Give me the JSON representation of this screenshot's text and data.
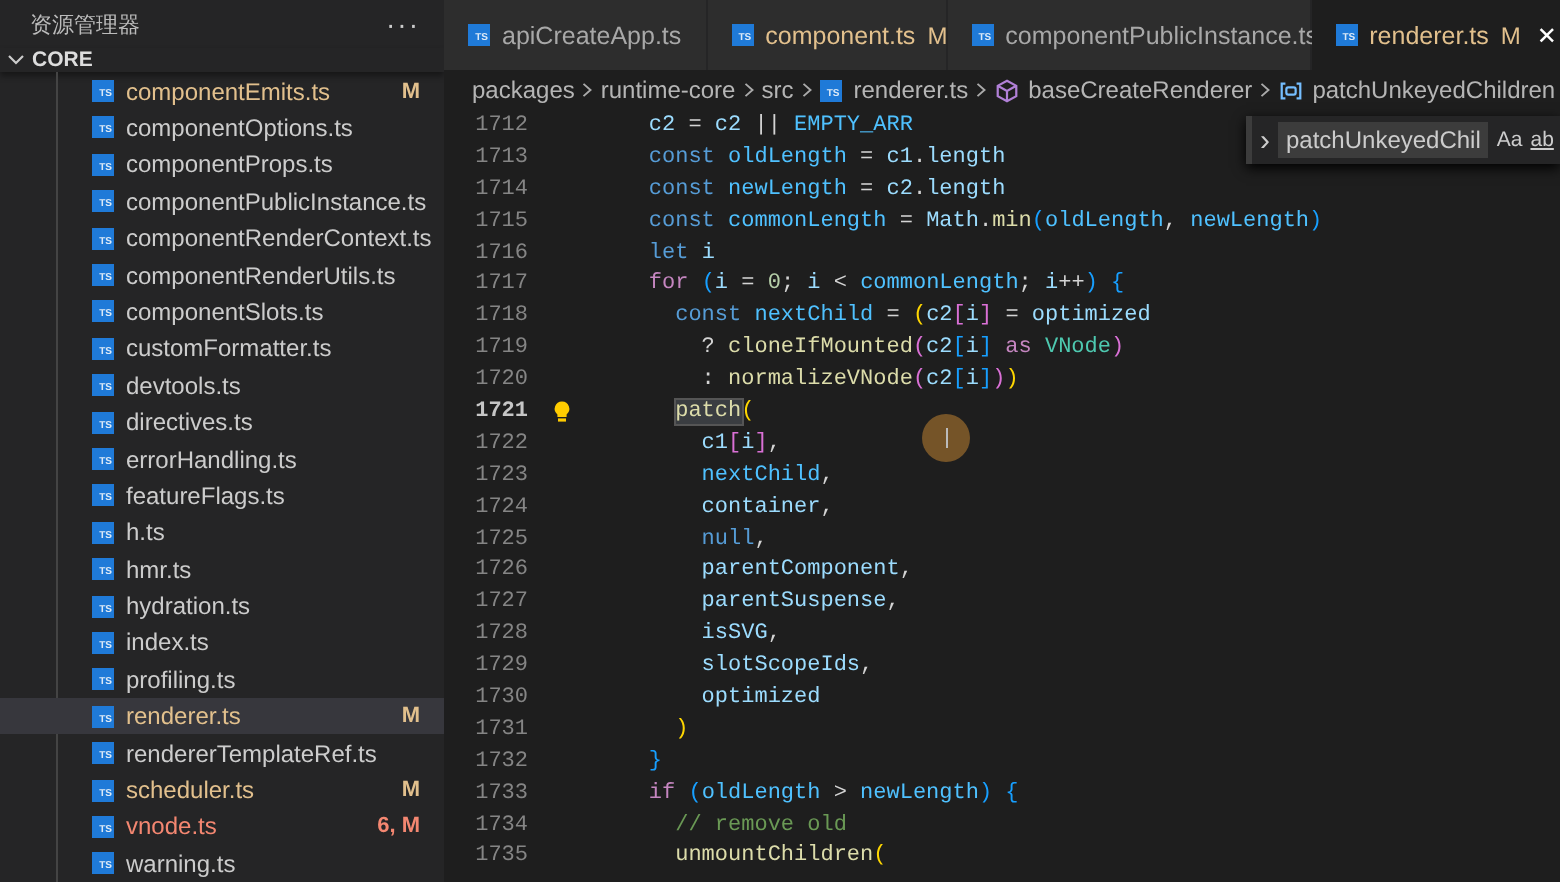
{
  "sidebar": {
    "title": "资源管理器",
    "more": "···",
    "section": {
      "label": "CORE",
      "expanded": true
    },
    "files": [
      {
        "badge": "TS",
        "name": "componentEmits.ts",
        "status": "M",
        "kind": "modified",
        "selected": false
      },
      {
        "badge": "TS",
        "name": "componentOptions.ts",
        "kind": "clean",
        "selected": false
      },
      {
        "badge": "TS",
        "name": "componentProps.ts",
        "kind": "clean",
        "selected": false
      },
      {
        "badge": "TS",
        "name": "componentPublicInstance.ts",
        "kind": "clean",
        "selected": false
      },
      {
        "badge": "TS",
        "name": "componentRenderContext.ts",
        "kind": "clean",
        "selected": false
      },
      {
        "badge": "TS",
        "name": "componentRenderUtils.ts",
        "kind": "clean",
        "selected": false
      },
      {
        "badge": "TS",
        "name": "componentSlots.ts",
        "kind": "clean",
        "selected": false
      },
      {
        "badge": "TS",
        "name": "customFormatter.ts",
        "kind": "clean",
        "selected": false
      },
      {
        "badge": "TS",
        "name": "devtools.ts",
        "kind": "clean",
        "selected": false
      },
      {
        "badge": "TS",
        "name": "directives.ts",
        "kind": "clean",
        "selected": false
      },
      {
        "badge": "TS",
        "name": "errorHandling.ts",
        "kind": "clean",
        "selected": false
      },
      {
        "badge": "TS",
        "name": "featureFlags.ts",
        "kind": "clean",
        "selected": false
      },
      {
        "badge": "TS",
        "name": "h.ts",
        "kind": "clean",
        "selected": false
      },
      {
        "badge": "TS",
        "name": "hmr.ts",
        "kind": "clean",
        "selected": false
      },
      {
        "badge": "TS",
        "name": "hydration.ts",
        "kind": "clean",
        "selected": false
      },
      {
        "badge": "TS",
        "name": "index.ts",
        "kind": "clean",
        "selected": false
      },
      {
        "badge": "TS",
        "name": "profiling.ts",
        "kind": "clean",
        "selected": false
      },
      {
        "badge": "TS",
        "name": "renderer.ts",
        "status": "M",
        "kind": "modified",
        "selected": true
      },
      {
        "badge": "TS",
        "name": "rendererTemplateRef.ts",
        "kind": "clean",
        "selected": false
      },
      {
        "badge": "TS",
        "name": "scheduler.ts",
        "status": "M",
        "kind": "modified",
        "selected": false
      },
      {
        "badge": "TS",
        "name": "vnode.ts",
        "status": "6, M",
        "kind": "error",
        "selected": false
      },
      {
        "badge": "TS",
        "name": "warning.ts",
        "kind": "clean",
        "selected": false
      }
    ]
  },
  "tabs": [
    {
      "badge": "TS",
      "label": "apiCreateApp.ts",
      "selected": false,
      "kind": "clean"
    },
    {
      "badge": "TS",
      "label": "component.ts",
      "status": "M",
      "selected": false,
      "kind": "modified"
    },
    {
      "badge": "TS",
      "label": "componentPublicInstance.ts",
      "selected": false,
      "kind": "clean"
    },
    {
      "badge": "TS",
      "label": "renderer.ts",
      "status": "M",
      "selected": true,
      "kind": "modified",
      "close": "✕"
    }
  ],
  "breadcrumb": [
    {
      "label": "packages",
      "kind": "folder"
    },
    {
      "label": "runtime-core",
      "kind": "folder"
    },
    {
      "label": "src",
      "kind": "folder"
    },
    {
      "label": "renderer.ts",
      "kind": "file",
      "badge": "TS"
    },
    {
      "label": "baseCreateRenderer",
      "kind": "function"
    },
    {
      "label": "patchUnkeyedChildren",
      "kind": "variable"
    }
  ],
  "find_widget": {
    "chevron": "›",
    "value": "patchUnkeyedChil",
    "match_case": "Aa",
    "whole_word": "ab"
  },
  "code": [
    {
      "number": "1712",
      "current": false,
      "tokens": [
        {
          "t": "    c2",
          "kind": "var"
        },
        {
          "t": " = ",
          "kind": "p"
        },
        {
          "t": "c2",
          "kind": "var"
        },
        {
          "t": " || ",
          "kind": "p"
        },
        {
          "t": "EMPTY_ARR",
          "kind": "const"
        }
      ]
    },
    {
      "number": "1713",
      "current": false,
      "tokens": [
        {
          "t": "    const",
          "kind": "kw"
        },
        {
          "t": " oldLength",
          "kind": "const"
        },
        {
          "t": " = ",
          "kind": "p"
        },
        {
          "t": "c1",
          "kind": "var"
        },
        {
          "t": ".",
          "kind": "p"
        },
        {
          "t": "length",
          "kind": "var"
        }
      ]
    },
    {
      "number": "1714",
      "current": false,
      "tokens": [
        {
          "t": "    const",
          "kind": "kw"
        },
        {
          "t": " newLength",
          "kind": "const"
        },
        {
          "t": " = ",
          "kind": "p"
        },
        {
          "t": "c2",
          "kind": "var"
        },
        {
          "t": ".",
          "kind": "p"
        },
        {
          "t": "length",
          "kind": "var"
        }
      ]
    },
    {
      "number": "1715",
      "current": false,
      "tokens": [
        {
          "t": "    const",
          "kind": "kw"
        },
        {
          "t": " commonLength",
          "kind": "const"
        },
        {
          "t": " = ",
          "kind": "p"
        },
        {
          "t": "Math",
          "kind": "var"
        },
        {
          "t": ".",
          "kind": "p"
        },
        {
          "t": "min",
          "kind": "fn"
        },
        {
          "t": "(",
          "kind": "b3"
        },
        {
          "t": "oldLength",
          "kind": "const"
        },
        {
          "t": ", ",
          "kind": "p"
        },
        {
          "t": "newLength",
          "kind": "const"
        },
        {
          "t": ")",
          "kind": "b3"
        }
      ]
    },
    {
      "number": "1716",
      "current": false,
      "tokens": [
        {
          "t": "    let",
          "kind": "kw"
        },
        {
          "t": " i",
          "kind": "var"
        }
      ]
    },
    {
      "number": "1717",
      "current": false,
      "tokens": [
        {
          "t": "    for",
          "kind": "ctrl"
        },
        {
          "t": " (",
          "kind": "b3"
        },
        {
          "t": "i",
          "kind": "var"
        },
        {
          "t": " = ",
          "kind": "p"
        },
        {
          "t": "0",
          "kind": "num"
        },
        {
          "t": "; ",
          "kind": "p"
        },
        {
          "t": "i",
          "kind": "var"
        },
        {
          "t": " < ",
          "kind": "p"
        },
        {
          "t": "commonLength",
          "kind": "const"
        },
        {
          "t": "; ",
          "kind": "p"
        },
        {
          "t": "i",
          "kind": "var"
        },
        {
          "t": "++",
          "kind": "p"
        },
        {
          "t": ") {",
          "kind": "b3"
        }
      ]
    },
    {
      "number": "1718",
      "current": false,
      "tokens": [
        {
          "t": "      const",
          "kind": "kw"
        },
        {
          "t": " nextChild",
          "kind": "const"
        },
        {
          "t": " = ",
          "kind": "p"
        },
        {
          "t": "(",
          "kind": "b1"
        },
        {
          "t": "c2",
          "kind": "var"
        },
        {
          "t": "[",
          "kind": "b2"
        },
        {
          "t": "i",
          "kind": "var"
        },
        {
          "t": "]",
          "kind": "b2"
        },
        {
          "t": " = ",
          "kind": "p"
        },
        {
          "t": "optimized",
          "kind": "var"
        }
      ]
    },
    {
      "number": "1719",
      "current": false,
      "tokens": [
        {
          "t": "        ? ",
          "kind": "p"
        },
        {
          "t": "cloneIfMounted",
          "kind": "fn"
        },
        {
          "t": "(",
          "kind": "b2"
        },
        {
          "t": "c2",
          "kind": "var"
        },
        {
          "t": "[",
          "kind": "b3"
        },
        {
          "t": "i",
          "kind": "var"
        },
        {
          "t": "]",
          "kind": "b3"
        },
        {
          "t": " as ",
          "kind": "ctrl"
        },
        {
          "t": "VNode",
          "kind": "type"
        },
        {
          "t": ")",
          "kind": "b2"
        }
      ]
    },
    {
      "number": "1720",
      "current": false,
      "tokens": [
        {
          "t": "        : ",
          "kind": "p"
        },
        {
          "t": "normalizeVNode",
          "kind": "fn"
        },
        {
          "t": "(",
          "kind": "b2"
        },
        {
          "t": "c2",
          "kind": "var"
        },
        {
          "t": "[",
          "kind": "b3"
        },
        {
          "t": "i",
          "kind": "var"
        },
        {
          "t": "]",
          "kind": "b3"
        },
        {
          "t": ")",
          "kind": "b2"
        },
        {
          "t": ")",
          "kind": "b1"
        }
      ]
    },
    {
      "number": "1721",
      "current": true,
      "tokens": [
        {
          "t": "      patch",
          "kind": "fn",
          "highlighted": true
        },
        {
          "t": "(",
          "kind": "b1",
          "highlighted": false
        }
      ]
    },
    {
      "number": "1722",
      "current": false,
      "tokens": [
        {
          "t": "        c1",
          "kind": "var"
        },
        {
          "t": "[",
          "kind": "b2"
        },
        {
          "t": "i",
          "kind": "var"
        },
        {
          "t": "]",
          "kind": "b2"
        },
        {
          "t": ",",
          "kind": "p"
        }
      ]
    },
    {
      "number": "1723",
      "current": false,
      "tokens": [
        {
          "t": "        nextChild",
          "kind": "const"
        },
        {
          "t": ",",
          "kind": "p"
        }
      ]
    },
    {
      "number": "1724",
      "current": false,
      "tokens": [
        {
          "t": "        container",
          "kind": "var"
        },
        {
          "t": ",",
          "kind": "p"
        }
      ]
    },
    {
      "number": "1725",
      "current": false,
      "tokens": [
        {
          "t": "        null",
          "kind": "kw"
        },
        {
          "t": ",",
          "kind": "p"
        }
      ]
    },
    {
      "number": "1726",
      "current": false,
      "tokens": [
        {
          "t": "        parentComponent",
          "kind": "var"
        },
        {
          "t": ",",
          "kind": "p"
        }
      ]
    },
    {
      "number": "1727",
      "current": false,
      "tokens": [
        {
          "t": "        parentSuspense",
          "kind": "var"
        },
        {
          "t": ",",
          "kind": "p"
        }
      ]
    },
    {
      "number": "1728",
      "current": false,
      "tokens": [
        {
          "t": "        isSVG",
          "kind": "var"
        },
        {
          "t": ",",
          "kind": "p"
        }
      ]
    },
    {
      "number": "1729",
      "current": false,
      "tokens": [
        {
          "t": "        slotScopeIds",
          "kind": "var"
        },
        {
          "t": ",",
          "kind": "p"
        }
      ]
    },
    {
      "number": "1730",
      "current": false,
      "tokens": [
        {
          "t": "        optimized",
          "kind": "var"
        }
      ]
    },
    {
      "number": "1731",
      "current": false,
      "tokens": [
        {
          "t": "      )",
          "kind": "b1"
        }
      ]
    },
    {
      "number": "1732",
      "current": false,
      "tokens": [
        {
          "t": "    }",
          "kind": "b3"
        }
      ]
    },
    {
      "number": "1733",
      "current": false,
      "tokens": [
        {
          "t": "    if",
          "kind": "ctrl"
        },
        {
          "t": " (",
          "kind": "b3"
        },
        {
          "t": "oldLength",
          "kind": "const"
        },
        {
          "t": " > ",
          "kind": "p"
        },
        {
          "t": "newLength",
          "kind": "const"
        },
        {
          "t": ") {",
          "kind": "b3"
        }
      ]
    },
    {
      "number": "1734",
      "current": false,
      "tokens": [
        {
          "t": "      // remove old",
          "kind": "comment"
        }
      ]
    },
    {
      "number": "1735",
      "current": false,
      "tokens": [
        {
          "t": "      unmountChildren",
          "kind": "fn"
        },
        {
          "t": "(",
          "kind": "b1"
        }
      ]
    }
  ]
}
